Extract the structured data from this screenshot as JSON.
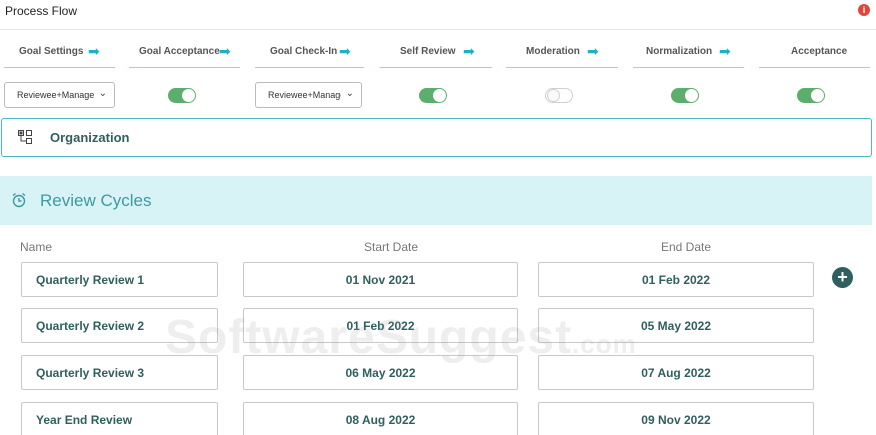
{
  "header": {
    "title": "Process Flow",
    "info_icon": "info-icon"
  },
  "steps": [
    {
      "label": "Goal Settings",
      "arrow": true
    },
    {
      "label": "Goal Acceptance",
      "arrow": true
    },
    {
      "label": "Goal Check-In",
      "arrow": true
    },
    {
      "label": "Self Review",
      "arrow": true
    },
    {
      "label": "Moderation",
      "arrow": true
    },
    {
      "label": "Normalization",
      "arrow": true
    },
    {
      "label": "Acceptance",
      "arrow": false
    }
  ],
  "controls": {
    "goal_settings_select": "Reviewee+Manager",
    "goal_acceptance_toggle": true,
    "goal_checkin_select": "Reviewee+Manager",
    "self_review_toggle": true,
    "moderation_toggle": false,
    "normalization_toggle": true,
    "acceptance_toggle": true
  },
  "organization": {
    "label": "Organization"
  },
  "review_cycles": {
    "title": "Review Cycles",
    "columns": {
      "name": "Name",
      "start": "Start Date",
      "end": "End Date"
    },
    "rows": [
      {
        "name": "Quarterly Review 1",
        "start": "01 Nov 2021",
        "end": "01 Feb 2022"
      },
      {
        "name": "Quarterly Review 2",
        "start": "01 Feb 2022",
        "end": "05 May 2022"
      },
      {
        "name": "Quarterly Review 3",
        "start": "06 May 2022",
        "end": "07 Aug 2022"
      },
      {
        "name": "Year End Review",
        "start": "08 Aug 2022",
        "end": "09 Nov 2022"
      }
    ],
    "add_label": "+"
  },
  "watermark": {
    "main": "SoftwareSuggest",
    "suffix": ".com"
  },
  "colors": {
    "accent": "#1cb2c4",
    "toggle_on": "#5cae6c",
    "text_dark": "#2f5f5f",
    "header_bg": "#d8f3f6"
  }
}
